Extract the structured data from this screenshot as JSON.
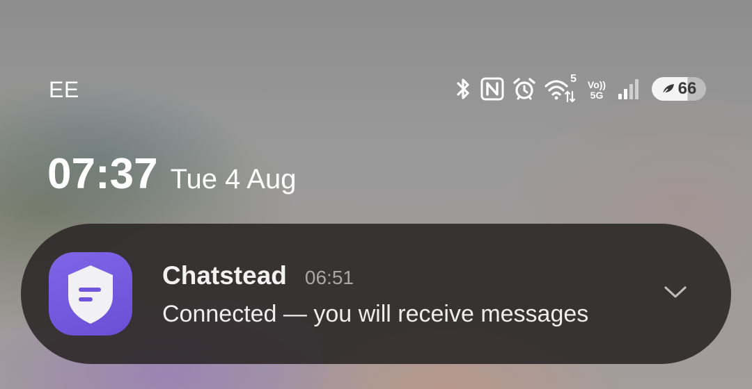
{
  "status_bar": {
    "carrier": "EE",
    "icons": [
      "bluetooth-icon",
      "nfc-icon",
      "alarm-icon",
      "wifi-icon",
      "volte-5g-icon",
      "signal-icon",
      "battery-icon"
    ],
    "wifi_badge": "5",
    "volte_top": "Vo))",
    "volte_bottom": "5G",
    "battery_level": "66",
    "battery_percent_fill": 66
  },
  "lock_screen": {
    "time": "07:37",
    "date": "Tue 4 Aug"
  },
  "notification": {
    "app_name": "Chatstead",
    "time": "06:51",
    "message": "Connected — you will receive messages",
    "icon": "shield-message-icon",
    "accent_color": "#6f54dc"
  }
}
